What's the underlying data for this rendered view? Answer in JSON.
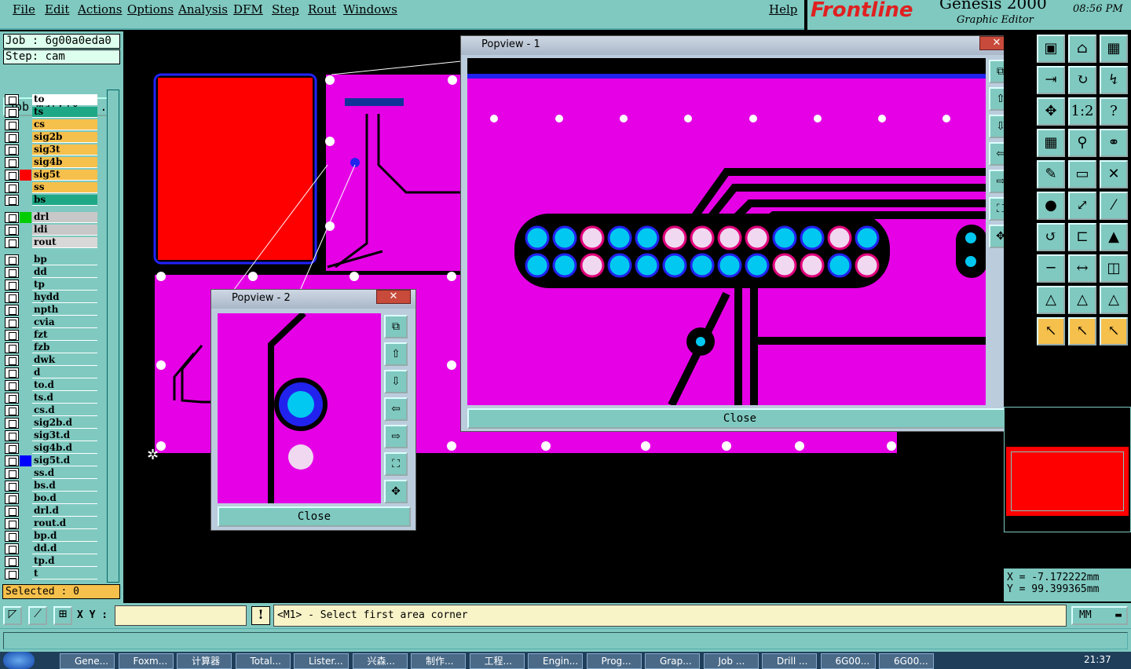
{
  "menu": {
    "items": [
      "File",
      "Edit",
      "Actions",
      "Options",
      "Analysis",
      "DFM",
      "Step",
      "Rout",
      "Windows"
    ],
    "help": "Help"
  },
  "brand": {
    "logo": "Frontline",
    "product": "Genesis 2000",
    "subtitle": "Graphic Editor",
    "time": "08:56 PM"
  },
  "job": {
    "job_text": "Job : 6g00a0eda0",
    "step_text": "Step: cam",
    "matrix_button": "Job Matrix ..."
  },
  "layers": [
    {
      "name": "to",
      "color": "#ffffff",
      "box": ""
    },
    {
      "name": "ts",
      "color": "#1fa886",
      "box": ""
    },
    {
      "name": "cs",
      "color": "#f6c04c",
      "box": ""
    },
    {
      "name": "sig2b",
      "color": "#f6c04c",
      "box": ""
    },
    {
      "name": "sig3t",
      "color": "#f6c04c",
      "box": ""
    },
    {
      "name": "sig4b",
      "color": "#f6c04c",
      "box": ""
    },
    {
      "name": "sig5t",
      "color": "#f6c04c",
      "box": "#ff0000"
    },
    {
      "name": "ss",
      "color": "#f6c04c",
      "box": ""
    },
    {
      "name": "bs",
      "color": "#1fa886",
      "box": ""
    },
    {
      "name": "drl",
      "color": "#c8c8c8",
      "box": "#00cc00"
    },
    {
      "name": "ldi",
      "color": "#c8c8c8",
      "box": ""
    },
    {
      "name": "rout",
      "color": "#d8d8d8",
      "box": ""
    },
    {
      "name": "bp",
      "color": "#7fc9c0",
      "box": ""
    },
    {
      "name": "dd",
      "color": "#7fc9c0",
      "box": ""
    },
    {
      "name": "tp",
      "color": "#7fc9c0",
      "box": ""
    },
    {
      "name": "hydd",
      "color": "#7fc9c0",
      "box": ""
    },
    {
      "name": "npth",
      "color": "#7fc9c0",
      "box": ""
    },
    {
      "name": "cvia",
      "color": "#7fc9c0",
      "box": ""
    },
    {
      "name": "fzt",
      "color": "#7fc9c0",
      "box": ""
    },
    {
      "name": "fzb",
      "color": "#7fc9c0",
      "box": ""
    },
    {
      "name": "dwk",
      "color": "#7fc9c0",
      "box": ""
    },
    {
      "name": "d",
      "color": "#7fc9c0",
      "box": ""
    },
    {
      "name": "to.d",
      "color": "#7fc9c0",
      "box": ""
    },
    {
      "name": "ts.d",
      "color": "#7fc9c0",
      "box": ""
    },
    {
      "name": "cs.d",
      "color": "#7fc9c0",
      "box": ""
    },
    {
      "name": "sig2b.d",
      "color": "#7fc9c0",
      "box": ""
    },
    {
      "name": "sig3t.d",
      "color": "#7fc9c0",
      "box": ""
    },
    {
      "name": "sig4b.d",
      "color": "#7fc9c0",
      "box": ""
    },
    {
      "name": "sig5t.d",
      "color": "#7fc9c0",
      "box": "#0000ff"
    },
    {
      "name": "ss.d",
      "color": "#7fc9c0",
      "box": ""
    },
    {
      "name": "bs.d",
      "color": "#7fc9c0",
      "box": ""
    },
    {
      "name": "bo.d",
      "color": "#7fc9c0",
      "box": ""
    },
    {
      "name": "drl.d",
      "color": "#7fc9c0",
      "box": ""
    },
    {
      "name": "rout.d",
      "color": "#7fc9c0",
      "box": ""
    },
    {
      "name": "bp.d",
      "color": "#7fc9c0",
      "box": ""
    },
    {
      "name": "dd.d",
      "color": "#7fc9c0",
      "box": ""
    },
    {
      "name": "tp.d",
      "color": "#7fc9c0",
      "box": ""
    },
    {
      "name": "t",
      "color": "#7fc9c0",
      "box": ""
    }
  ],
  "selected_text": "Selected : 0",
  "popview1": {
    "title": "Popview - 1",
    "close_label": "Close",
    "x_label": "✕"
  },
  "popview2": {
    "title": "Popview - 2",
    "close_label": "Close",
    "x_label": "✕"
  },
  "coords": {
    "x_text": "X = -7.172222mm",
    "y_text": "Y = 99.399365mm"
  },
  "cmd": {
    "xy_label": "X Y :",
    "xy_value": "",
    "prompt": "<M1> - Select first area corner",
    "units": "MM",
    "warn": "!"
  },
  "taskbar": {
    "items": [
      "Gene...",
      "Foxm...",
      "计算器",
      "Total...",
      "Lister...",
      "兴森...",
      "制作...",
      "工程...",
      "Engin...",
      "Prog...",
      "Grap...",
      "Job ...",
      "Drill ...",
      "6G00...",
      "6G00..."
    ],
    "clock": "21:37"
  },
  "colors": {
    "teal": "#7fc9c0",
    "magenta": "#e600e6",
    "copper_pad": "#00c8f0"
  }
}
